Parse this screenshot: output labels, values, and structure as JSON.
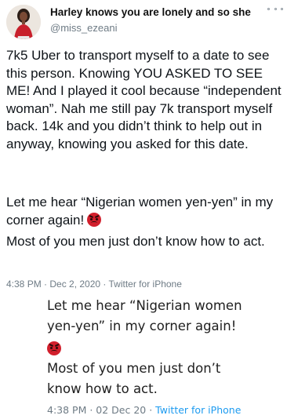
{
  "header": {
    "display_name": "Harley knows you are lonely and so she",
    "handle": "@miss_ezeani",
    "more_icon": "ellipsis-icon"
  },
  "tweet": {
    "paragraph_1": "7k5 Uber to transport myself to a date to see this person. Knowing YOU ASKED TO SEE ME! And I played it cool because “independent woman”. Nah me still pay 7k transport myself back. 14k and you didn’t think to help out in anyway, knowing you asked for this date.",
    "paragraph_2": "Let me hear “Nigerian women yen-yen” in my corner again!",
    "paragraph_3": "Most of you men just don’t know how to act.",
    "emoji": "angry-face-emoji",
    "timestamp": "4:38 PM · Dec 2, 2020 · Twitter for iPhone"
  },
  "quoted_screenshot": {
    "line_1": "Let me hear “Nigerian women",
    "line_2": "yen-yen” in my corner again!",
    "line_3": "Most of you men just don’t",
    "line_4": "know how to act.",
    "emoji": "angry-face-emoji",
    "meta_time": "4:38 PM · 02 Dec 20 · ",
    "meta_source": "Twitter for iPhone"
  },
  "colors": {
    "text": "#0f1419",
    "secondary": "#6e7b85",
    "link": "#1d9bf0",
    "emoji_red": "#d21f2c"
  }
}
